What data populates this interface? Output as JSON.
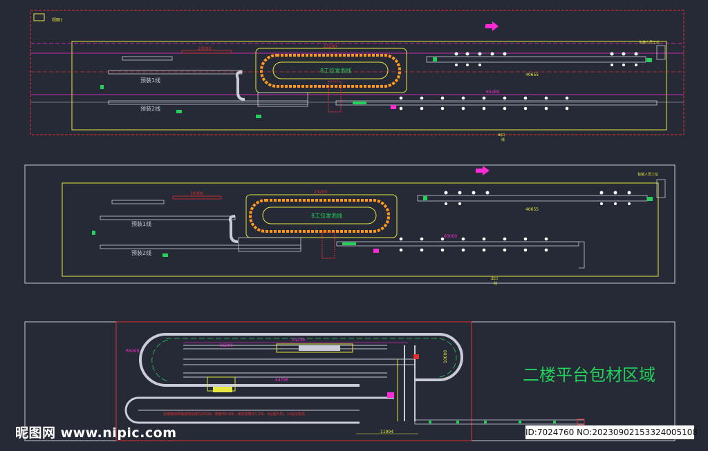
{
  "panel1": {
    "frame_label": "视图1",
    "top_right_note": "包装人员工位",
    "bottom_note_1": "出口",
    "bottom_note_2": "线",
    "line_pre1": "预装1线",
    "line_pre2": "预装2线",
    "loop_label": "8工位发泡线",
    "dim_top": "23200",
    "dim_left": "10000",
    "dim_right_upper": "40655",
    "dim_right_lower": "65289"
  },
  "panel2": {
    "top_right_note": "包装人员工位",
    "bottom_note_1": "出口",
    "bottom_note_2": "线",
    "line_pre1": "预装1线",
    "line_pre2": "预装2线",
    "loop_label": "8工位发泡线",
    "dim_top": "23200",
    "dim_left": "10000",
    "dim_right_upper": "40655",
    "dim_right_lower": "60000"
  },
  "panel3": {
    "title": "二楼平台包材区域",
    "dim_top": "53239",
    "dim_left": "16201",
    "dim_mid": "44795",
    "dim_right": "10000",
    "dim_bottom": "11994",
    "radius_note": "R5000",
    "red_note": "包装箱线体输送线长度约200米，宽度约0.8米，线体高度约1.2米，4台提升机，12台分拣机"
  },
  "watermark": {
    "left": "昵图网 www.nipic.com",
    "right": "ID:7024760 NO:20230902153324005108"
  },
  "colors": {
    "background": "#252a36",
    "frame": "#c9ccd6",
    "yellow": "#e8e640",
    "magenta": "#ff2bd6",
    "green": "#22d05a",
    "red": "#e03030",
    "orange": "#ff9a1f"
  }
}
